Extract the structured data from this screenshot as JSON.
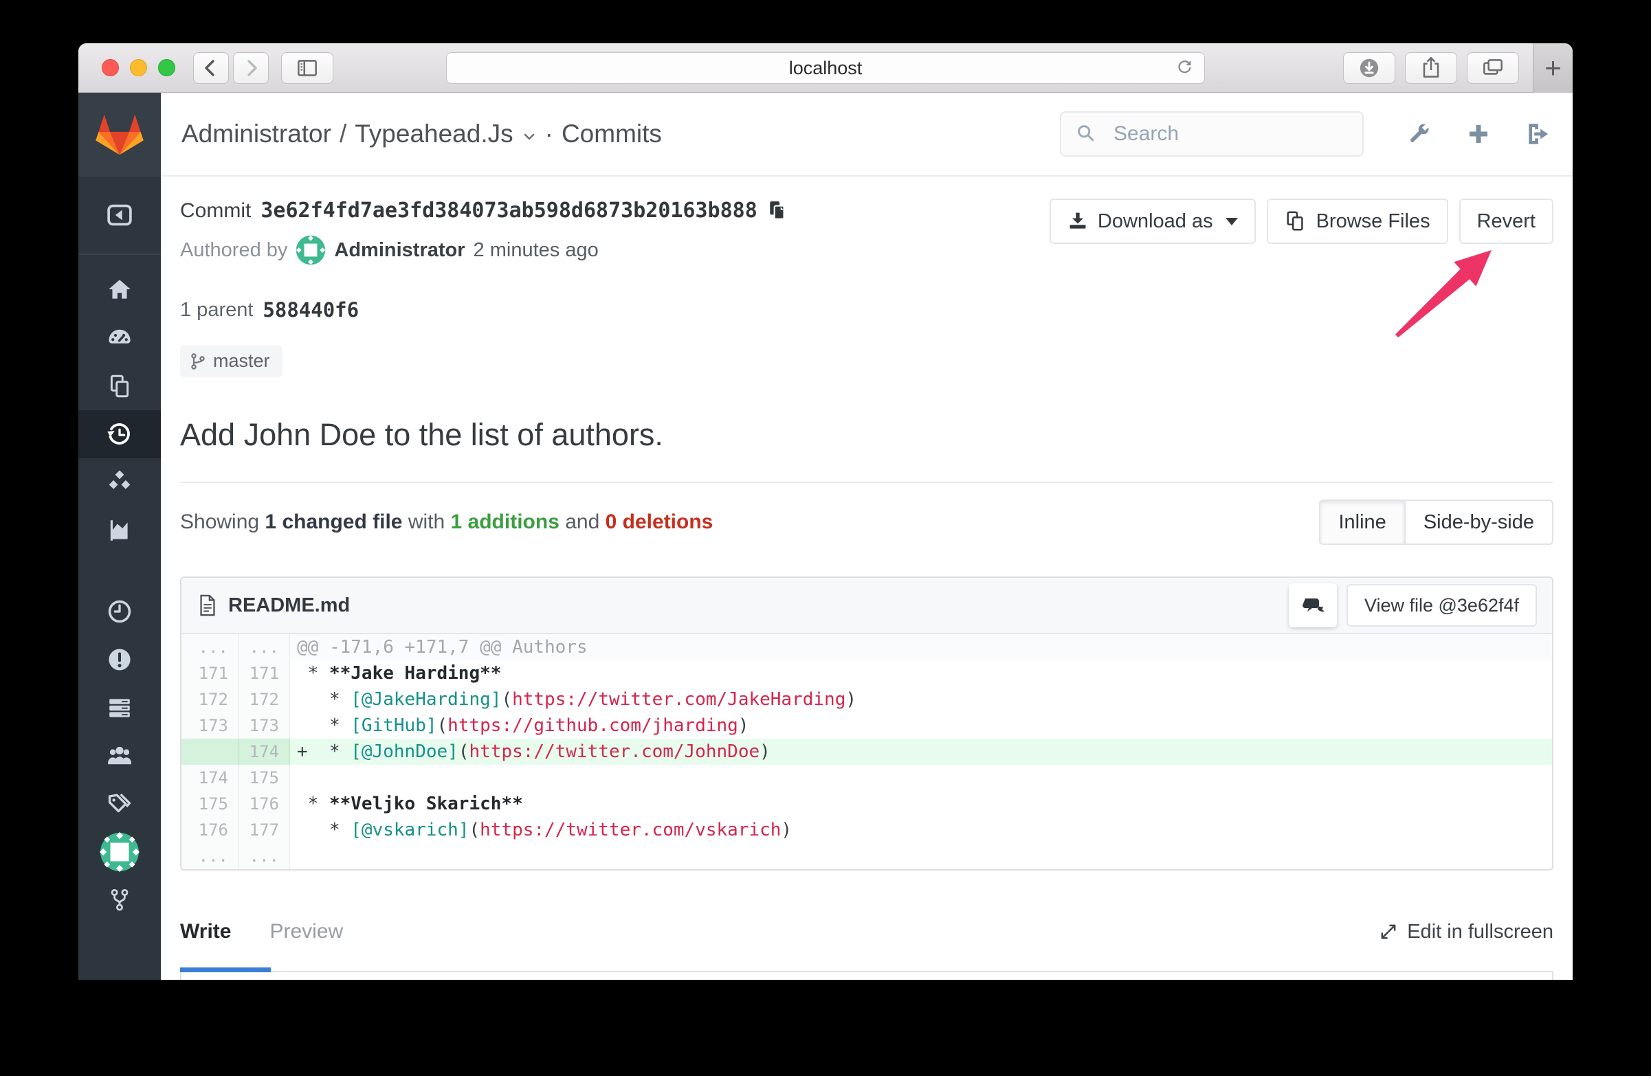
{
  "browser": {
    "url": "localhost",
    "traffic_lights": [
      "close",
      "minimize",
      "zoom"
    ],
    "toolbar_icons": [
      "back-chevron",
      "forward-chevron",
      "sidebar-toggle",
      "page-refresh",
      "downloads",
      "share",
      "tabs-overview",
      "new-tab"
    ],
    "new_tab_glyph": "+"
  },
  "colors": {
    "arrow_pink": "#ee3467",
    "sidebar_bg": "#2d353e",
    "avatar_teal": "#3eb991",
    "additions_green": "#3c9e40",
    "deletions_red": "#c62f1e",
    "code_link_teal": "#14918a",
    "code_string_red": "#d6254d",
    "active_tab_blue": "#3b7ed8"
  },
  "sidebar": {
    "icons": [
      "gitlab-logo",
      "collapse",
      "home",
      "dashboard",
      "projects",
      "history",
      "packages",
      "analytics",
      "time",
      "issues",
      "servers",
      "users",
      "labels",
      "profile-avatar",
      "fork"
    ],
    "active": "history"
  },
  "header": {
    "breadcrumb": {
      "owner": "Administrator",
      "separator": "/",
      "project": "Typeahead.Js",
      "dot": "·",
      "section": "Commits"
    },
    "search_placeholder": "Search",
    "icons": [
      "wrench",
      "plus",
      "sign-out"
    ]
  },
  "commit": {
    "label": "Commit",
    "sha": "3e62f4fd7ae3fd384073ab598d6873b20163b888",
    "authored_by": "Authored by",
    "author": "Administrator",
    "time_ago": "2 minutes ago",
    "parent_label": "1 parent",
    "parent_sha": "588440f6",
    "branch": "master",
    "buttons": {
      "download": "Download as",
      "browse": "Browse Files",
      "revert": "Revert"
    },
    "title": "Add John Doe to the list of authors."
  },
  "stats": {
    "prefix": "Showing",
    "changed": "1 changed file",
    "with": "with",
    "additions": "1 additions",
    "and": "and",
    "deletions": "0 deletions"
  },
  "view_modes": {
    "inline": "Inline",
    "side_by_side": "Side-by-side"
  },
  "diff": {
    "file_name": "README.md",
    "view_file_label": "View file @3e62f4f",
    "rows": [
      {
        "old": "...",
        "new": "...",
        "cls": "hunk",
        "segs": [
          {
            "t": "@@ -171,6 +171,7 @@ Authors",
            "c": "meta"
          }
        ]
      },
      {
        "old": "171",
        "new": "171",
        "segs": [
          {
            "t": " * ",
            "c": "p"
          },
          {
            "t": "**Jake Harding**",
            "c": "b"
          }
        ]
      },
      {
        "old": "172",
        "new": "172",
        "segs": [
          {
            "t": "   * ",
            "c": "p"
          },
          {
            "t": "[@JakeHarding]",
            "c": "t"
          },
          {
            "t": "(",
            "c": "p"
          },
          {
            "t": "https://twitter.com/JakeHarding",
            "c": "r"
          },
          {
            "t": ")",
            "c": "p"
          }
        ]
      },
      {
        "old": "173",
        "new": "173",
        "segs": [
          {
            "t": "   * ",
            "c": "p"
          },
          {
            "t": "[GitHub]",
            "c": "t"
          },
          {
            "t": "(",
            "c": "p"
          },
          {
            "t": "https://github.com/jharding",
            "c": "r"
          },
          {
            "t": ")",
            "c": "p"
          }
        ]
      },
      {
        "old": "",
        "new": "174",
        "cls": "add",
        "mark": "+",
        "segs": [
          {
            "t": "  * ",
            "c": "p"
          },
          {
            "t": "[@JohnDoe]",
            "c": "t"
          },
          {
            "t": "(",
            "c": "p"
          },
          {
            "t": "https://twitter.com/JohnDoe",
            "c": "r"
          },
          {
            "t": ")",
            "c": "p"
          }
        ]
      },
      {
        "old": "174",
        "new": "175",
        "segs": []
      },
      {
        "old": "175",
        "new": "176",
        "segs": [
          {
            "t": " * ",
            "c": "p"
          },
          {
            "t": "**Veljko Skarich**",
            "c": "b"
          }
        ]
      },
      {
        "old": "176",
        "new": "177",
        "segs": [
          {
            "t": "   * ",
            "c": "p"
          },
          {
            "t": "[@vskarich]",
            "c": "t"
          },
          {
            "t": "(",
            "c": "p"
          },
          {
            "t": "https://twitter.com/vskarich",
            "c": "r"
          },
          {
            "t": ")",
            "c": "p"
          }
        ]
      },
      {
        "old": "...",
        "new": "...",
        "cls": "match",
        "segs": []
      }
    ]
  },
  "editor": {
    "tabs": [
      "Write",
      "Preview"
    ],
    "active_tab": "Write",
    "fullscreen_label": "Edit in fullscreen"
  }
}
